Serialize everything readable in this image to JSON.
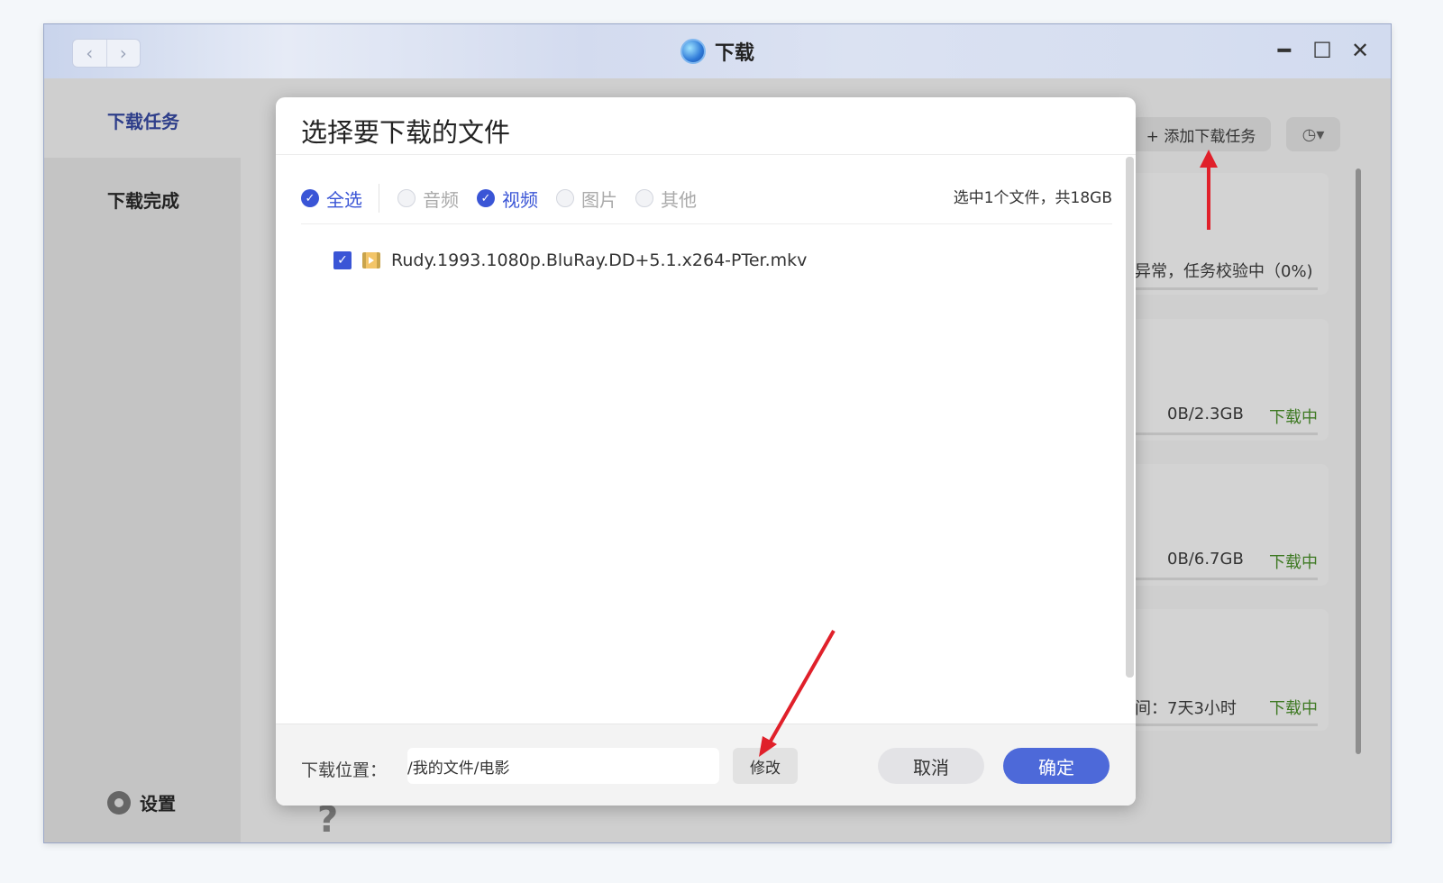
{
  "window": {
    "title": "下载",
    "nav_back_glyph": "‹",
    "nav_forward_glyph": "›",
    "controls": {
      "minimize_glyph": "━",
      "maximize_glyph": "☐",
      "close_glyph": "✕"
    }
  },
  "sidebar": {
    "items": [
      {
        "label": "下载任务",
        "active": true
      },
      {
        "label": "下载完成",
        "active": false
      }
    ],
    "settings_label": "设置"
  },
  "toolbar": {
    "add_task_label": "+ 添加下载任务",
    "clock_glyph": "◷▾"
  },
  "background_tasks": [
    {
      "text": "异常，任务校验中（0%)",
      "status": ""
    },
    {
      "text": "0B/2.3GB",
      "status": "下载中"
    },
    {
      "text": "0B/6.7GB",
      "status": "下载中"
    },
    {
      "text": "间：7天3小时",
      "status": "下载中"
    }
  ],
  "dialog": {
    "title": "选择要下载的文件",
    "filters": [
      {
        "label": "全选",
        "checked": true
      },
      {
        "label": "音频",
        "checked": false
      },
      {
        "label": "视频",
        "checked": true
      },
      {
        "label": "图片",
        "checked": false
      },
      {
        "label": "其他",
        "checked": false
      }
    ],
    "summary": "选中1个文件，共18GB",
    "files": [
      {
        "name": "Rudy.1993.1080p.BluRay.DD+5.1.x264-PTer.mkv",
        "checked": true,
        "icon": "video-file-icon"
      }
    ],
    "footer": {
      "location_label": "下载位置：",
      "location_value": "/我的文件/电影",
      "modify_label": "修改",
      "cancel_label": "取消",
      "ok_label": "确定"
    }
  },
  "colors": {
    "accent": "#3a55d6",
    "primary_button": "#4d69d9",
    "status_downloading": "#3f7a24",
    "annotation_arrow": "#e0202a"
  }
}
